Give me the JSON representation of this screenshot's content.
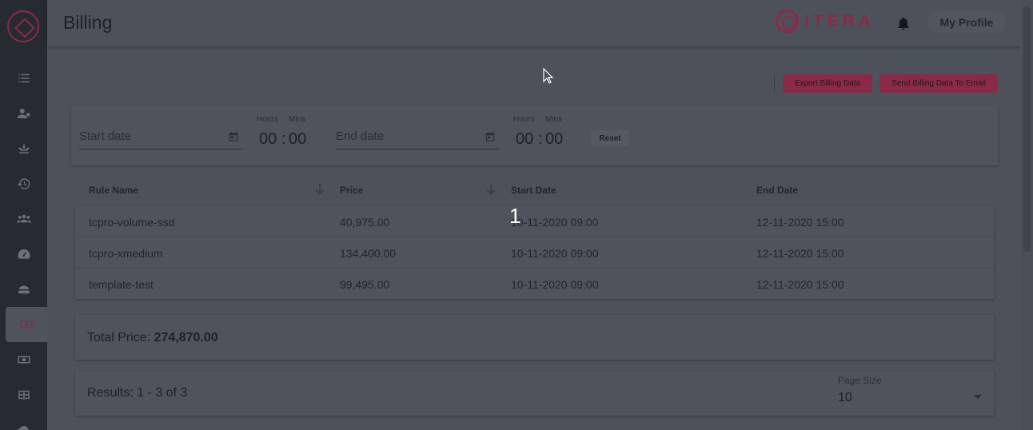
{
  "header": {
    "title": "Billing",
    "brand": "ITERA",
    "profile_label": "My Profile"
  },
  "sidebar": {
    "items": [
      {
        "icon": "list-icon"
      },
      {
        "icon": "users-key-icon"
      },
      {
        "icon": "lotus-icon"
      },
      {
        "icon": "history-icon"
      },
      {
        "icon": "group-icon"
      },
      {
        "icon": "dashboard-icon"
      },
      {
        "icon": "server-icon"
      },
      {
        "icon": "billing-icon",
        "active": true
      },
      {
        "icon": "money-icon"
      },
      {
        "icon": "grid-icon"
      },
      {
        "icon": "cloud-icon"
      }
    ]
  },
  "actions": {
    "export_label": "Export Billing Data",
    "send_label": "Send Billing Data To Email"
  },
  "filter": {
    "start_placeholder": "Start date",
    "end_placeholder": "End date",
    "hours_label": "Hours",
    "mins_label": "Mins",
    "start_hours": "00",
    "start_mins": "00",
    "end_hours": "00",
    "end_mins": "00",
    "separator": ":",
    "reset_label": "Reset"
  },
  "table": {
    "columns": [
      "Rule Name",
      "Price",
      "Start Date",
      "End Date"
    ],
    "rows": [
      [
        "tcpro-volume-ssd",
        "40,975.00",
        "10-11-2020 09:00",
        "12-11-2020 15:00"
      ],
      [
        "tcpro-xmedium",
        "134,400.00",
        "10-11-2020 09:00",
        "12-11-2020 15:00"
      ],
      [
        "template-test",
        "99,495.00",
        "10-11-2020 09:00",
        "12-11-2020 15:00"
      ]
    ]
  },
  "total": {
    "label": "Total Price:",
    "value": "274,870.00"
  },
  "pagination": {
    "results": "Results: 1 - 3 of 3",
    "page_size_label": "Page Size",
    "page_size_value": "10"
  },
  "overlay": {
    "step_number": "1"
  },
  "colors": {
    "accent": "#8a2a48",
    "sidebar_bg": "#262a31",
    "page_bg": "#4d515a"
  }
}
